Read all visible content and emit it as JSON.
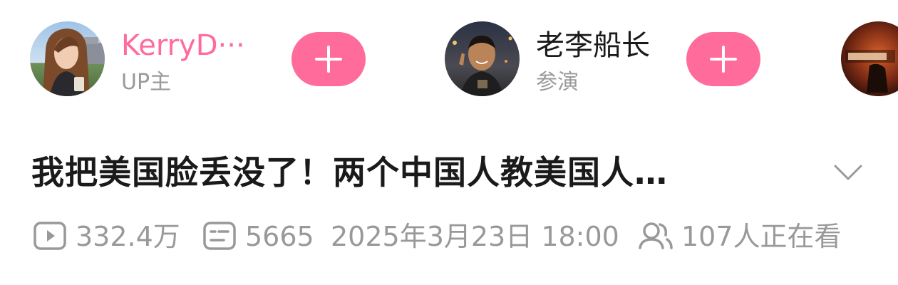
{
  "creators": [
    {
      "name": "KerryD···",
      "role": "UP主",
      "name_color": "#ff6b9a"
    },
    {
      "name": "老李船长",
      "role": "参演",
      "name_color": "#1a1a1a"
    }
  ],
  "follow_icon": "plus-icon",
  "video": {
    "title": "我把美国脸丢没了！两个中国人教美国人…",
    "views": "332.4万",
    "danmaku": "5665",
    "date": "2025年3月23日 18:00",
    "watching": "107人正在看"
  },
  "colors": {
    "accent": "#ff6b9a",
    "meta_text": "#999999",
    "title_text": "#1a1a1a"
  }
}
